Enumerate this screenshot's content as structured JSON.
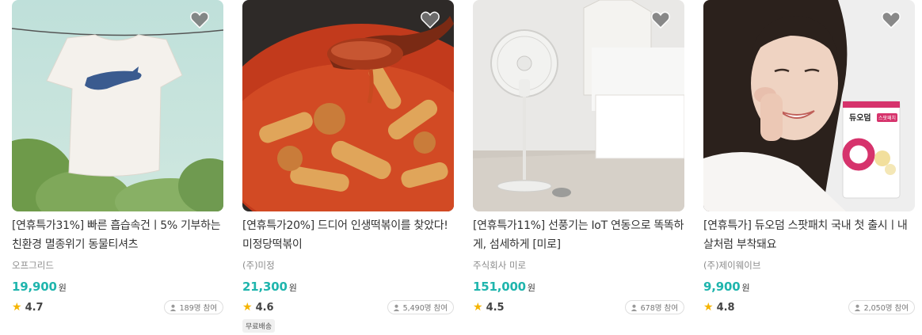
{
  "colors": {
    "price": "#1fb5ad",
    "star": "#f5b400",
    "text": "#333333",
    "muted": "#8a8a8a"
  },
  "products": [
    {
      "title": "[연휴특가31%] 빠른 흡습속건ㅣ5% 기부하는 친환경 멸종위기 동물티셔츠",
      "maker": "오프그리드",
      "price": "19,900",
      "currency": "원",
      "rating": "4.7",
      "participants": "189명 참여",
      "badge": "",
      "image": "t-shirt-with-dolphin-print-on-clothesline",
      "icon": "heart-icon"
    },
    {
      "title": "[연휴특가20%] 드디어 인생떡볶이를 찾았다! 미정당떡볶이",
      "maker": "(주)미정",
      "price": "21,300",
      "currency": "원",
      "rating": "4.6",
      "participants": "5,490명 참여",
      "badge": "무료배송",
      "image": "tteokbokki-with-spoon",
      "icon": "heart-icon"
    },
    {
      "title": "[연휴특가11%] 선풍기는 IoT 연동으로 똑똑하게, 섬세하게 [미로]",
      "maker": "주식회사 미로",
      "price": "151,000",
      "currency": "원",
      "rating": "4.5",
      "participants": "678명 참여",
      "badge": "",
      "image": "white-standing-fan-in-bedroom",
      "icon": "heart-icon"
    },
    {
      "title": "[연휴특가] 듀오덤 스팟패치 국내 첫 출시ㅣ내 살처럼 부착돼요",
      "maker": "(주)제이웨이브",
      "price": "9,900",
      "currency": "원",
      "rating": "4.8",
      "participants": "2,050명 참여",
      "badge": "",
      "image": "woman-with-duoderm-spot-patch-box",
      "icon": "heart-icon",
      "box_text": "듀오덤",
      "box_sub": "스팟패치"
    }
  ]
}
